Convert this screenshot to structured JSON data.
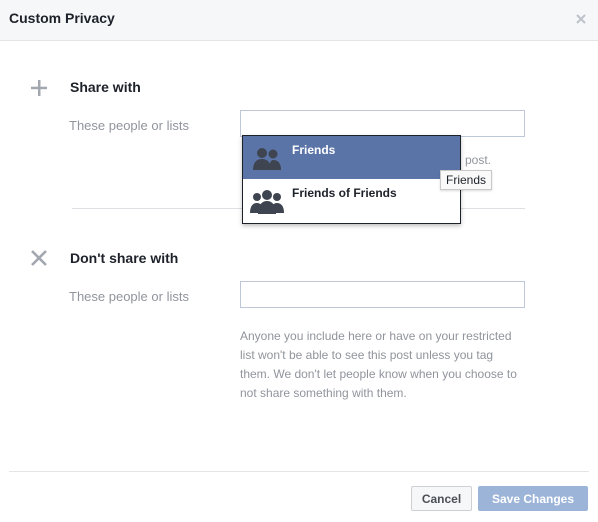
{
  "dialog": {
    "title": "Custom Privacy",
    "close_glyph": "×"
  },
  "share_with": {
    "title": "Share with",
    "field_label": "These people or lists",
    "input_value": "",
    "hint_tail": "post."
  },
  "dropdown": {
    "items": [
      {
        "label": "Friends",
        "icon": "friends-icon",
        "selected": true
      },
      {
        "label": "Friends of Friends",
        "icon": "friends-of-friends-icon",
        "selected": false
      }
    ],
    "tooltip": "Friends"
  },
  "dont_share_with": {
    "title": "Don't share with",
    "field_label": "These people or lists",
    "input_value": "",
    "help_text": "Anyone you include here or have on your restricted list won't be able to see this post unless you tag them. We don't let people know when you choose to not share something with them."
  },
  "footer": {
    "cancel_label": "Cancel",
    "save_label": "Save Changes"
  },
  "colors": {
    "selected_item_bg": "#5b74a8",
    "save_button_bg": "#9cb4d8",
    "muted_text": "#90949c"
  }
}
